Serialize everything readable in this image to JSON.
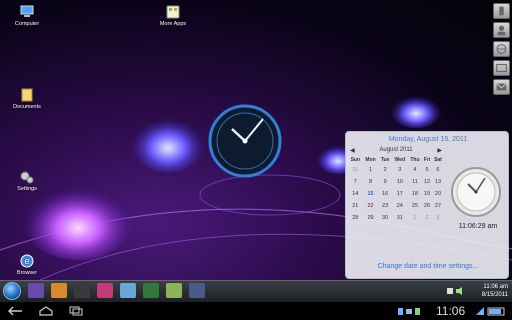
{
  "desktop": {
    "icons": [
      {
        "label": "Computer",
        "icon": "computer-icon"
      },
      {
        "label": "More Apps",
        "icon": "more-apps-icon"
      },
      {
        "label": "Documents",
        "icon": "documents-icon"
      },
      {
        "label": "Settings",
        "icon": "settings-icon"
      },
      {
        "label": "Browser",
        "icon": "browser-icon"
      }
    ]
  },
  "calendar": {
    "header": "Monday, August 15, 2011",
    "month": "August 2011",
    "weekdays": [
      "Sun",
      "Mon",
      "Tue",
      "Wed",
      "Thu",
      "Fri",
      "Sat"
    ],
    "rows": [
      [
        "31",
        "1",
        "2",
        "3",
        "4",
        "5",
        "6"
      ],
      [
        "7",
        "8",
        "9",
        "10",
        "11",
        "12",
        "13"
      ],
      [
        "14",
        "15",
        "16",
        "17",
        "18",
        "19",
        "20"
      ],
      [
        "21",
        "22",
        "23",
        "24",
        "25",
        "26",
        "27"
      ],
      [
        "28",
        "29",
        "30",
        "31",
        "1",
        "2",
        "3"
      ]
    ],
    "today": "15",
    "time": "11:06:29 am",
    "link": "Change date and time settings..."
  },
  "taskbar": {
    "time": "11:06 am",
    "date": "8/15/2011"
  },
  "sysbar": {
    "time": "11:06"
  },
  "colors": {
    "accent": "#3b73d1",
    "taskbar": "#2a2d33"
  }
}
